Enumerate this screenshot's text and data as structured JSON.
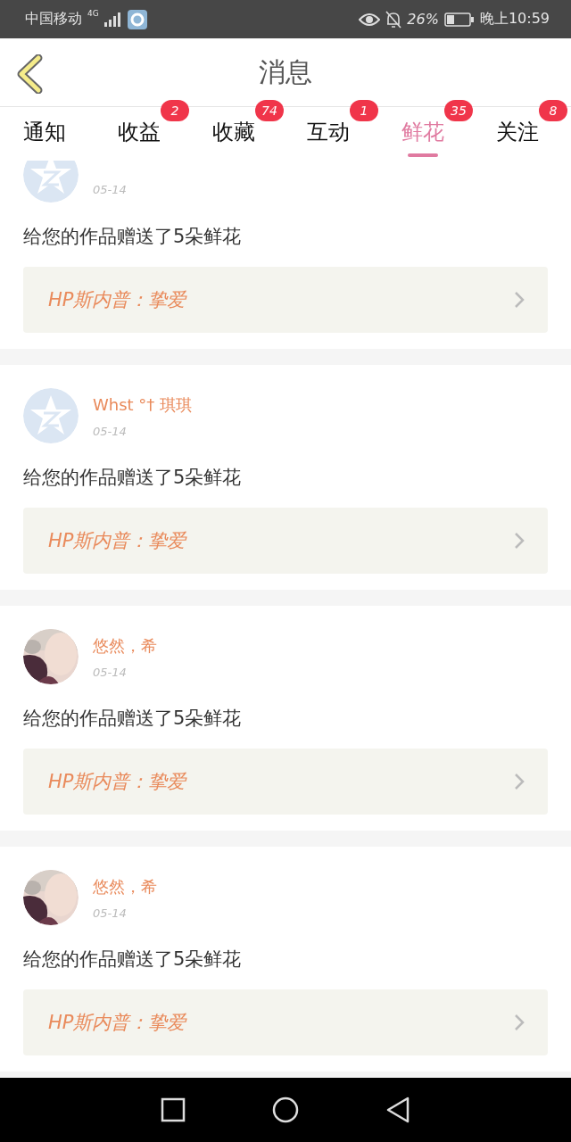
{
  "status_bar": {
    "carrier": "中国移动",
    "network": "4G",
    "battery": "26%",
    "time": "晚上10:59"
  },
  "header": {
    "title": "消息"
  },
  "tabs": [
    {
      "label": "通知",
      "selected": false
    },
    {
      "label": "收益",
      "badge": "2",
      "selected": false
    },
    {
      "label": "收藏",
      "badge": "74",
      "selected": false
    },
    {
      "label": "互动",
      "badge": "1",
      "selected": false
    },
    {
      "label": "鲜花",
      "badge": "35",
      "selected": true
    },
    {
      "label": "关注",
      "badge": "8",
      "selected": false
    }
  ],
  "messages": [
    {
      "kind": "default",
      "date": "05-14",
      "text": "给您的作品赠送了5朵鲜花",
      "work": "HP斯内普：挚爱"
    },
    {
      "kind": "default",
      "name": "Whst °† 琪琪",
      "date": "05-14",
      "text": "给您的作品赠送了5朵鲜花",
      "work": "HP斯内普：挚爱"
    },
    {
      "kind": "picture",
      "name": "悠然，希",
      "date": "05-14",
      "text": "给您的作品赠送了5朵鲜花",
      "work": "HP斯内普：挚爱"
    },
    {
      "kind": "picture",
      "name": "悠然，希",
      "date": "05-14",
      "text": "给您的作品赠送了5朵鲜花",
      "work": "HP斯内普：挚爱"
    }
  ]
}
